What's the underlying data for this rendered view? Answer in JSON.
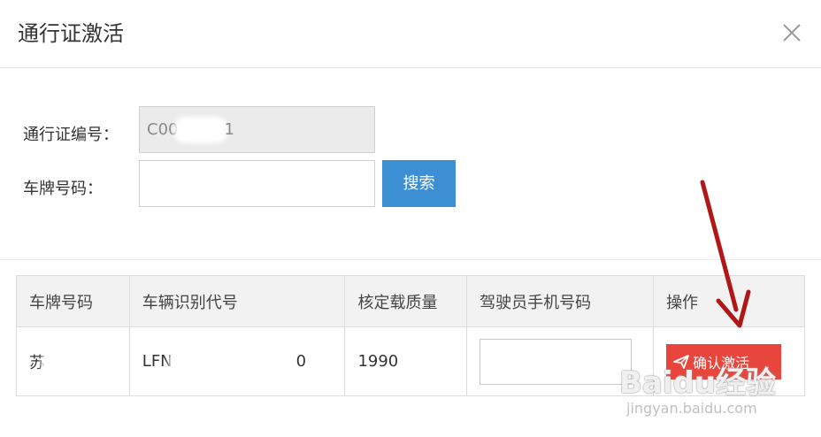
{
  "dialog": {
    "title": "通行证激活",
    "close_icon": "close-icon"
  },
  "form": {
    "pass_label": "通行证编号：",
    "pass_value_prefix": "C00",
    "pass_value_suffix": "1",
    "plate_label": "车牌号码：",
    "plate_value": "",
    "search_label": "搜索"
  },
  "table": {
    "headers": [
      "车牌号码",
      "车辆识别代号",
      "核定载质量",
      "驾驶员手机号码",
      "操作"
    ],
    "rows": [
      {
        "plate_prefix": "苏",
        "vin_prefix": "LFN",
        "vin_suffix": "0",
        "load": "1990",
        "phone": "",
        "action_label": "确认激活",
        "action_icon": "send-icon"
      }
    ]
  },
  "watermark": {
    "text": "Baidu经验",
    "url": "jingyan.baidu.com"
  },
  "colors": {
    "primary": "#3d8fd4",
    "danger": "#e8453c",
    "arrow": "#b01818"
  }
}
